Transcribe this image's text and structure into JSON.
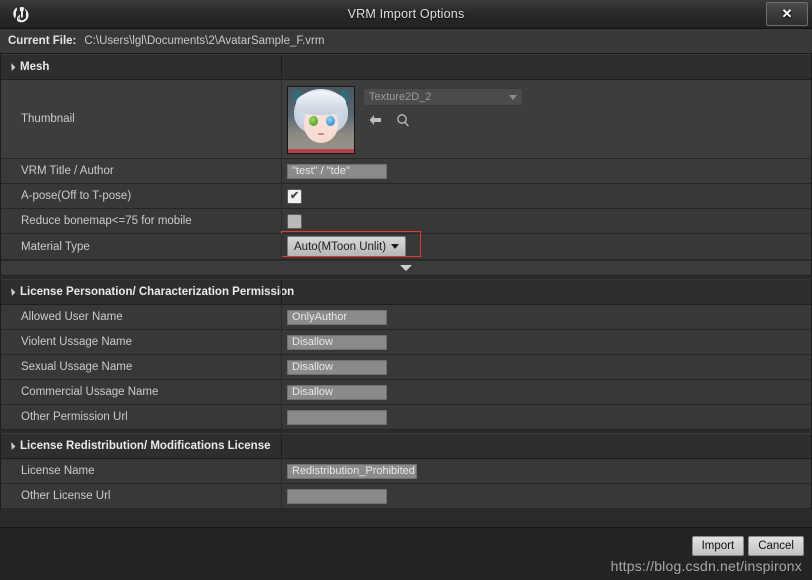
{
  "window": {
    "title": "VRM Import Options",
    "logo_icon": "unreal-engine-logo",
    "close_label": "✕"
  },
  "file_bar": {
    "label": "Current File:",
    "path": "C:\\Users\\lgl\\Documents\\2\\AvatarSample_F.vrm"
  },
  "sections": {
    "mesh": {
      "title": "Mesh",
      "rows": {
        "thumbnail": {
          "label": "Thumbnail",
          "asset_value": "Texture2D_2",
          "browse_icon": "back-arrow-icon",
          "find_icon": "search-icon"
        },
        "vrm_title_author": {
          "label": "VRM Title / Author",
          "value": "\"test\" / \"tde\""
        },
        "a_pose": {
          "label": "A-pose(Off to T-pose)",
          "checked": true,
          "check_glyph": "✔"
        },
        "reduce_bonemap": {
          "label": "Reduce bonemap<=75 for mobile",
          "checked": false,
          "check_glyph": ""
        },
        "material_type": {
          "label": "Material Type",
          "value": "Auto(MToon Unlit)",
          "highlight_color": "#e03a3a"
        }
      }
    },
    "license_permission": {
      "title": "License Personation/ Characterization Permission",
      "rows": [
        {
          "label": "Allowed User Name",
          "value": "OnlyAuthor"
        },
        {
          "label": "Violent Ussage Name",
          "value": "Disallow"
        },
        {
          "label": "Sexual Ussage Name",
          "value": "Disallow"
        },
        {
          "label": "Commercial Ussage Name",
          "value": "Disallow"
        },
        {
          "label": "Other Permission Url",
          "value": ""
        }
      ]
    },
    "license_redistribution": {
      "title": "License Redistribution/ Modifications License",
      "rows": [
        {
          "label": "License Name",
          "value": "Redistribution_Prohibited"
        },
        {
          "label": "Other License Url",
          "value": ""
        }
      ]
    }
  },
  "footer": {
    "import_label": "Import",
    "cancel_label": "Cancel",
    "watermark": "https://blog.csdn.net/inspironx"
  }
}
